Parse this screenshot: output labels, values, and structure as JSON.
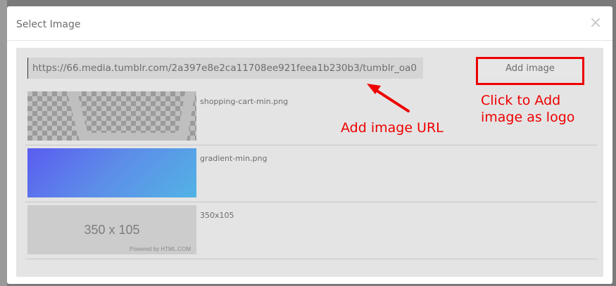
{
  "modal": {
    "title": "Select Image",
    "close_label": "×"
  },
  "url_input": {
    "value": "https://66.media.tumblr.com/2a397e8e2ca11708ee921feea1b230b3/tumblr_oa0"
  },
  "add_button": {
    "label": "Add image"
  },
  "images": [
    {
      "filename": "shopping-cart-min.png",
      "kind": "transparent"
    },
    {
      "filename": "gradient-min.png",
      "kind": "gradient"
    },
    {
      "filename": "350x105",
      "kind": "placeholder",
      "placeholder_text": "350 x 105",
      "placeholder_sub": "Powered by HTML.COM"
    }
  ],
  "annotations": {
    "url_hint": "Add image URL",
    "button_hint_line1": "Click to Add",
    "button_hint_line2": "image as logo",
    "color": "#ee0000"
  }
}
